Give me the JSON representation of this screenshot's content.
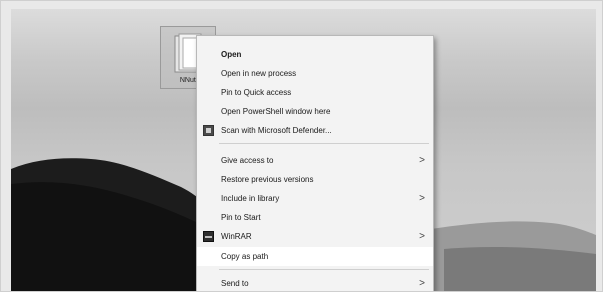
{
  "desktop": {
    "folder_label": "NNutr"
  },
  "context_menu": {
    "items": [
      {
        "label": "Open"
      },
      {
        "label": "Open in new process"
      },
      {
        "label": "Pin to Quick access"
      },
      {
        "label": "Open PowerShell window here"
      },
      {
        "label": "Scan with Microsoft Defender...",
        "icon": "defender-icon"
      },
      {
        "label": "Give access to",
        "submenu": true
      },
      {
        "label": "Restore previous versions"
      },
      {
        "label": "Include in library",
        "submenu": true
      },
      {
        "label": "Pin to Start"
      },
      {
        "label": "WinRAR",
        "icon": "winrar-icon",
        "submenu": true
      },
      {
        "label": "Copy as path",
        "highlighted": true
      },
      {
        "label": "Send to",
        "submenu": true
      }
    ],
    "submenu_glyph": ">"
  }
}
